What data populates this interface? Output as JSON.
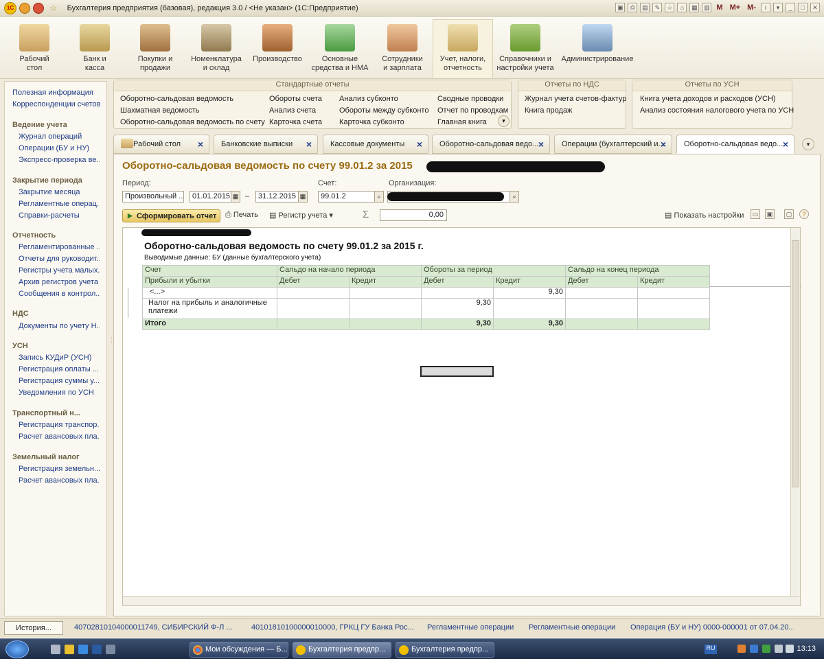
{
  "window": {
    "title": "Бухгалтерия предприятия (базовая), редакция 3.0 / <Не указан> (1С:Предприятие)",
    "m": "M",
    "mplus": "M+",
    "mminus": "M-"
  },
  "sections": [
    {
      "label": "Рабочий\nстол",
      "icon": "desk-icon"
    },
    {
      "label": "Банк и\nкасса",
      "icon": "bank-icon"
    },
    {
      "label": "Покупки и\nпродажи",
      "icon": "truck-icon"
    },
    {
      "label": "Номенклатура\nи склад",
      "icon": "warehouse-icon"
    },
    {
      "label": "Производство",
      "icon": "tools-icon"
    },
    {
      "label": "Основные\nсредства и НМА",
      "icon": "assets-icon"
    },
    {
      "label": "Сотрудники\nи зарплата",
      "icon": "employee-icon"
    },
    {
      "label": "Учет, налоги,\nотчетность",
      "icon": "accounting-icon"
    },
    {
      "label": "Справочники и\nнастройки учета",
      "icon": "books-icon"
    },
    {
      "label": "Администрирование",
      "icon": "computer-icon"
    }
  ],
  "left": {
    "links": [
      "Полезная информация",
      "Корреспонденции счетов"
    ],
    "groups": [
      {
        "title": "Ведение учета",
        "items": [
          "Журнал операций",
          "Операции (БУ и НУ)",
          "Экспресс-проверка ве..."
        ]
      },
      {
        "title": "Закрытие периода",
        "items": [
          "Закрытие месяца",
          "Регламентные операц...",
          "Справки-расчеты"
        ]
      },
      {
        "title": "Отчетность",
        "items": [
          "Регламентированные ...",
          "Отчеты для руководит...",
          "Регистры учета малых...",
          "Архив регистров учета",
          "Сообщения в контрол..."
        ]
      },
      {
        "title": "НДС",
        "items": [
          "Документы по учету Н..."
        ]
      },
      {
        "title": "УСН",
        "items": [
          "Запись КУДиР (УСН)",
          "Регистрация оплаты ...",
          "Регистрация суммы у...",
          "Уведомления по УСН"
        ]
      },
      {
        "title": "Транспортный н...",
        "items": [
          "Регистрация транспор...",
          "Расчет авансовых пла..."
        ]
      },
      {
        "title": "Земельный налог",
        "items": [
          "Регистрация земельн...",
          "Расчет авансовых пла..."
        ]
      }
    ]
  },
  "cmd": {
    "std_title": "Стандартные отчеты",
    "std": [
      "Оборотно-сальдовая ведомость",
      "Шахматная ведомость",
      "Оборотно-сальдовая ведомость по счету",
      "Обороты счета",
      "Анализ счета",
      "Карточка счета",
      "Анализ субконто",
      "Обороты между субконто",
      "Карточка субконто",
      "Сводные проводки",
      "Отчет по проводкам",
      "Главная книга"
    ],
    "nds_title": "Отчеты по НДС",
    "nds": [
      "Журнал учета счетов-фактур",
      "Книга продаж"
    ],
    "usn_title": "Отчеты по УСН",
    "usn": [
      "Книга учета доходов и расходов (УСН)",
      "Анализ состояния налогового учета по УСН"
    ]
  },
  "tabs": [
    "Рабочий стол",
    "Банковские выписки",
    "Кассовые документы",
    "Оборотно-сальдовая ведо...",
    "Операции (бухгалтерский и...",
    "Оборотно-сальдовая ведо..."
  ],
  "form": {
    "title": "Оборотно-сальдовая ведомость по счету 99.01.2 за 2015",
    "period_label": "Период:",
    "period_type": "Произвольный ...",
    "date_from": "01.01.2015",
    "dash": "–",
    "date_to": "31.12.2015",
    "account_label": "Счет:",
    "account": "99.01.2",
    "org_label": "Организация:",
    "run": "Сформировать отчет",
    "print": "Печать",
    "register": "Регистр учета",
    "sigma": "Σ",
    "sum": "0,00",
    "show_settings": "Показать настройки"
  },
  "report": {
    "title": "Оборотно-сальдовая ведомость по счету 99.01.2 за 2015 г.",
    "subtitle": "Выводимые данные:  БУ (данные бухгалтерского учета)",
    "h1": [
      "Счет",
      "Сальдо на начало периода",
      "Обороты за период",
      "Сальдо на конец периода"
    ],
    "h2": [
      "Прибыли и убытки",
      "Дебет",
      "Кредит",
      "Дебет",
      "Кредит",
      "Дебет",
      "Кредит"
    ],
    "rows": [
      [
        "<...>",
        "",
        "",
        "",
        "9,30",
        "",
        ""
      ],
      [
        "Налог на прибыль и аналогичные платежи",
        "",
        "",
        "9,30",
        "",
        "",
        ""
      ]
    ],
    "total": [
      "Итого",
      "",
      "",
      "9,30",
      "9,30",
      "",
      ""
    ]
  },
  "status": {
    "history": "История...",
    "items": [
      "4070281010400001174​9, СИБИРСКИЙ Ф-Л ...",
      "40101810100000010000, ГРКЦ ГУ Банка Рос...",
      "Регламентные операции",
      "Регламентные операции",
      "Операция (БУ и НУ) 0000-000001 от 07.04.20..."
    ]
  },
  "taskbar": {
    "items": [
      "Мои обсуждения — Б...",
      "Бухгалтерия предпр...",
      "Бухгалтерия предпр..."
    ],
    "lang": "RU",
    "clock": "13:13"
  }
}
